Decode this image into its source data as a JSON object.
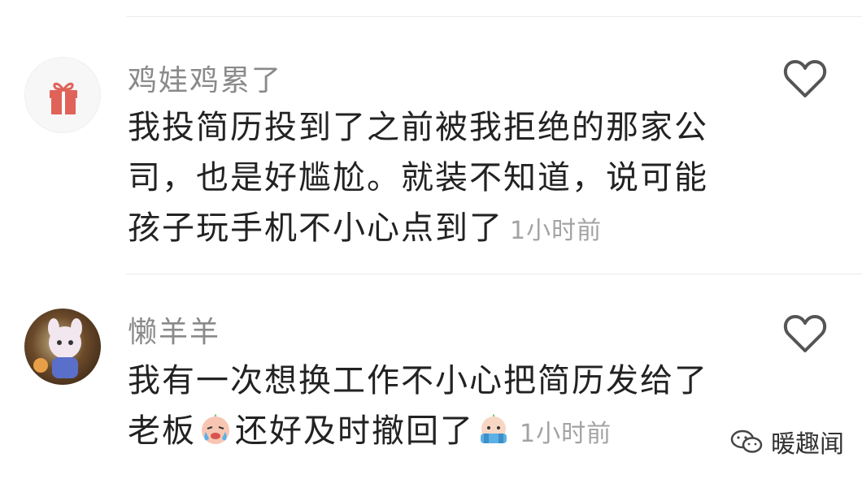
{
  "comments": [
    {
      "username": "鸡娃鸡累了",
      "avatar": "gift-icon",
      "text": "我投简历投到了之前被我拒绝的那家公司，也是好尴尬。就装不知道，说可能孩子玩手机不小心点到了",
      "time": "1小时前",
      "like_icon": "heart-outline-icon"
    },
    {
      "username": "懒羊羊",
      "avatar": "plush-toy-photo",
      "text_part1": "我有一次想换工作不小心把简历发给了老板",
      "emoji1": "crying-emoji",
      "text_part2": "还好及时撤回了",
      "emoji2": "scared-emoji",
      "time": "1小时前",
      "like_icon": "heart-outline-icon"
    }
  ],
  "watermark": {
    "icon": "wechat-icon",
    "text": "暖趣闻"
  }
}
